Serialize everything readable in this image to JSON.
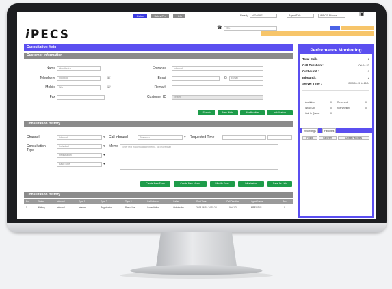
{
  "topbar": {
    "buttons": [
      "Guide",
      "Sales Pro",
      "Help"
    ],
    "ready_label": "Ready",
    "ready_value": "NEWBIE",
    "agent_value": "AgentTalk",
    "account_value": "iPECS Phone"
  },
  "header": {
    "logo_left": "i",
    "logo_right": "PECS",
    "call_icon": "phone-icon",
    "call_field": "TEL"
  },
  "consultation": {
    "title": "Consultation Main"
  },
  "customer": {
    "title": "Customer Information",
    "name_label": "Name",
    "name_value": "Abbott's Inc",
    "telephone_label": "Telephone",
    "telephone_value": "5555555",
    "mobile_label": "Mobile",
    "mobile_value": "N/A",
    "fax_label": "Fax",
    "fax_value": "",
    "entrance_label": "Entrance",
    "entrance_value": "Inbound",
    "email_label": "Email",
    "email_value": "",
    "email_domain": "E-mail",
    "remark_label": "Remark",
    "remark_value": "",
    "customer_id_label": "Customer ID",
    "customer_id_value": "TRMR",
    "actions": [
      "Search",
      "New Write",
      "Modification",
      "Initialization"
    ]
  },
  "history": {
    "title": "Consultation History",
    "channel_label": "Channel",
    "channel_value": "Inbound",
    "callinbound_label": "Call inbound",
    "callinbound_value": "Customer",
    "requested_label": "Requested Time",
    "requested_value": "",
    "cons_type_label": "Consultation Type",
    "type_values": [
      "Individual",
      "Registration",
      "Basic Line"
    ],
    "memo_label": "Memo",
    "memo_placeholder": "Enter text in consultation memo. No more than",
    "actions": [
      "Create New Form",
      "Create New Memo",
      "Modify Save",
      "Initialization",
      "Save As Link"
    ]
  },
  "history_table": {
    "title": "Consultation History",
    "headers": [
      "No.",
      "Status",
      "Inbound",
      "Type 1",
      "Type 2",
      "Type 3",
      "Call Inbound",
      "Caller",
      "Start Time",
      "Call Duration",
      "Agent Name",
      "Rec"
    ],
    "row": [
      "1",
      "Waiting",
      "Inbound",
      "Internet",
      "Registration",
      "Basic Line",
      "Consultation",
      "Abbotts Inc",
      "2013-06-19 14:15:24",
      "00:01:24",
      "MPECS 01",
      "Y"
    ]
  },
  "performance": {
    "title": "Performance Monitoring",
    "stats": [
      {
        "label": "Total Calls :",
        "value": "2"
      },
      {
        "label": "Call Duration :",
        "value": "00:04:23"
      },
      {
        "label": "Outbound :",
        "value": "0"
      },
      {
        "label": "Inbound :",
        "value": "2"
      },
      {
        "label": "Server Time :",
        "value": "2013-06-19 14:15:24"
      }
    ],
    "status": [
      {
        "label": "Available",
        "value": "0"
      },
      {
        "label": "Reserved",
        "value": "0"
      },
      {
        "label": "Wrap-Up",
        "value": "0"
      },
      {
        "label": "Not Working",
        "value": "0"
      },
      {
        "label": "Call In Queue",
        "value": "0"
      }
    ],
    "tabs": [
      "Recordings",
      "Favorites"
    ],
    "sub_buttons": [
      "Follow",
      "Favorites",
      "Delete Favorites"
    ]
  },
  "colors": {
    "accent": "#5b4ff0",
    "header_gray": "#8b8b8b",
    "action_green": "#1e9c4a",
    "orange": "#f7c56a"
  }
}
